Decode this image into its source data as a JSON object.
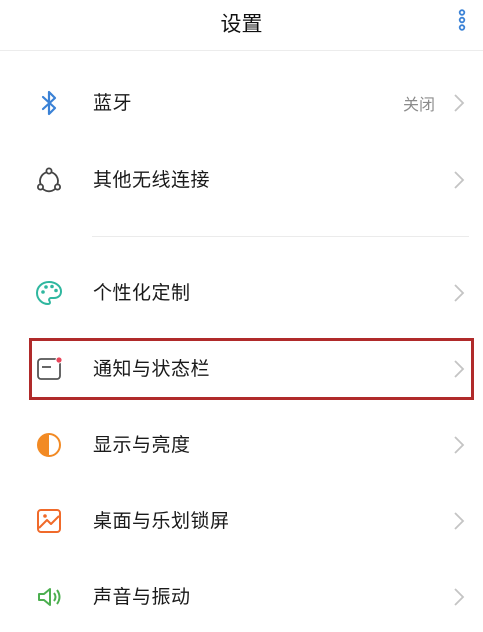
{
  "header": {
    "title": "设置"
  },
  "items": [
    {
      "label": "蓝牙",
      "value": "关闭",
      "icon": "bluetooth-icon",
      "icon_color": "#3b82d6"
    },
    {
      "label": "其他无线连接",
      "value": "",
      "icon": "wireless-connection-icon",
      "icon_color": "#444444"
    },
    {
      "label": "个性化定制",
      "value": "",
      "icon": "palette-icon",
      "icon_color": "#2fb79f"
    },
    {
      "label": "通知与状态栏",
      "value": "",
      "icon": "notification-icon",
      "icon_color": "#555555"
    },
    {
      "label": "显示与亮度",
      "value": "",
      "icon": "brightness-icon",
      "icon_color": "#f28a24"
    },
    {
      "label": "桌面与乐划锁屏",
      "value": "",
      "icon": "wallpaper-icon",
      "icon_color": "#f06a2a"
    },
    {
      "label": "声音与振动",
      "value": "",
      "icon": "sound-vibration-icon",
      "icon_color": "#4caf50"
    }
  ],
  "colors": {
    "highlight_border": "#b02a2a",
    "chevron": "#c4c4c4",
    "accent": "#3b82d6"
  }
}
